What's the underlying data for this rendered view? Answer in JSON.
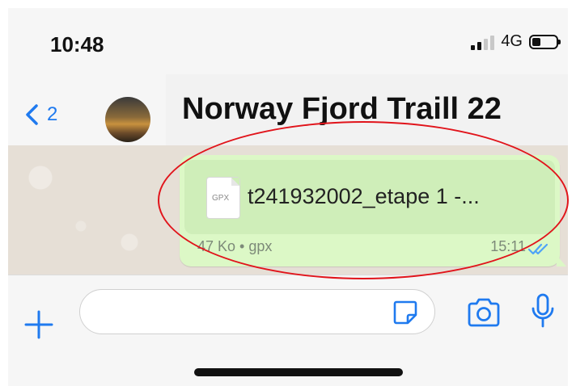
{
  "status_bar": {
    "time": "10:48",
    "network": "4G"
  },
  "header": {
    "back_count": "2",
    "title": "Norway Fjord Traill 22"
  },
  "message": {
    "file_ext": "GPX",
    "file_name": "t241932002_etape 1 -...",
    "file_meta": "47 Ko • gpx",
    "time": "15:11"
  },
  "composer": {
    "placeholder": ""
  },
  "colors": {
    "accent": "#1f7aef",
    "bubble": "#dcf8c6",
    "highlight": "#e1141b"
  }
}
